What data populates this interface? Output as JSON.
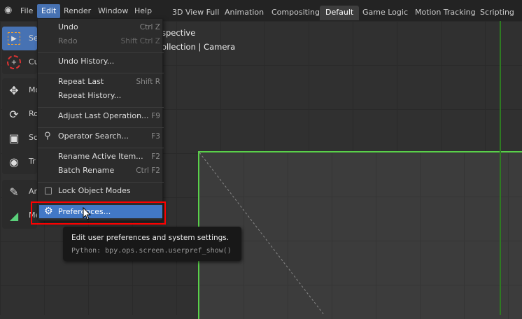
{
  "menubar": {
    "items": [
      "File",
      "Edit",
      "Render",
      "Window",
      "Help"
    ],
    "active": "Edit"
  },
  "workspaces": {
    "tabs": [
      "3D View Full",
      "Animation",
      "Compositing",
      "Default",
      "Game Logic",
      "Motion Tracking",
      "Scripting"
    ],
    "active": "Default"
  },
  "viewport": {
    "line1": "spective",
    "line2": "ollection | Camera"
  },
  "toolbar": {
    "tools": [
      {
        "label": "Se",
        "icon": "select-box-icon"
      },
      {
        "label": "Cu",
        "icon": "cursor-icon"
      },
      {
        "label": "Mo",
        "icon": "move-icon"
      },
      {
        "label": "Ro",
        "icon": "rotate-icon"
      },
      {
        "label": "Sc",
        "icon": "scale-icon"
      },
      {
        "label": "Tr",
        "icon": "transform-icon"
      },
      {
        "label": "An",
        "icon": "annotate-icon"
      },
      {
        "label": "Me",
        "icon": "measure-icon"
      }
    ]
  },
  "edit_menu": {
    "items": [
      {
        "label": "Undo",
        "shortcut": "Ctrl Z"
      },
      {
        "label": "Redo",
        "shortcut": "Shift Ctrl Z"
      },
      {
        "label": "Undo History...",
        "shortcut": ""
      },
      {
        "label": "Repeat Last",
        "shortcut": "Shift R"
      },
      {
        "label": "Repeat History...",
        "shortcut": ""
      },
      {
        "label": "Adjust Last Operation...",
        "shortcut": "F9"
      },
      {
        "label": "Operator Search...",
        "shortcut": "F3"
      },
      {
        "label": "Rename Active Item...",
        "shortcut": "F2"
      },
      {
        "label": "Batch Rename",
        "shortcut": "Ctrl F2"
      },
      {
        "label": "Lock Object Modes",
        "shortcut": ""
      },
      {
        "label": "Preferences...",
        "shortcut": ""
      }
    ]
  },
  "tooltip": {
    "description": "Edit user preferences and system settings.",
    "python": "Python: bpy.ops.screen.userpref_show()"
  },
  "colors": {
    "accent": "#4772b3",
    "highlight_box": "#ff0000",
    "camera_frame": "#5ad04a"
  }
}
